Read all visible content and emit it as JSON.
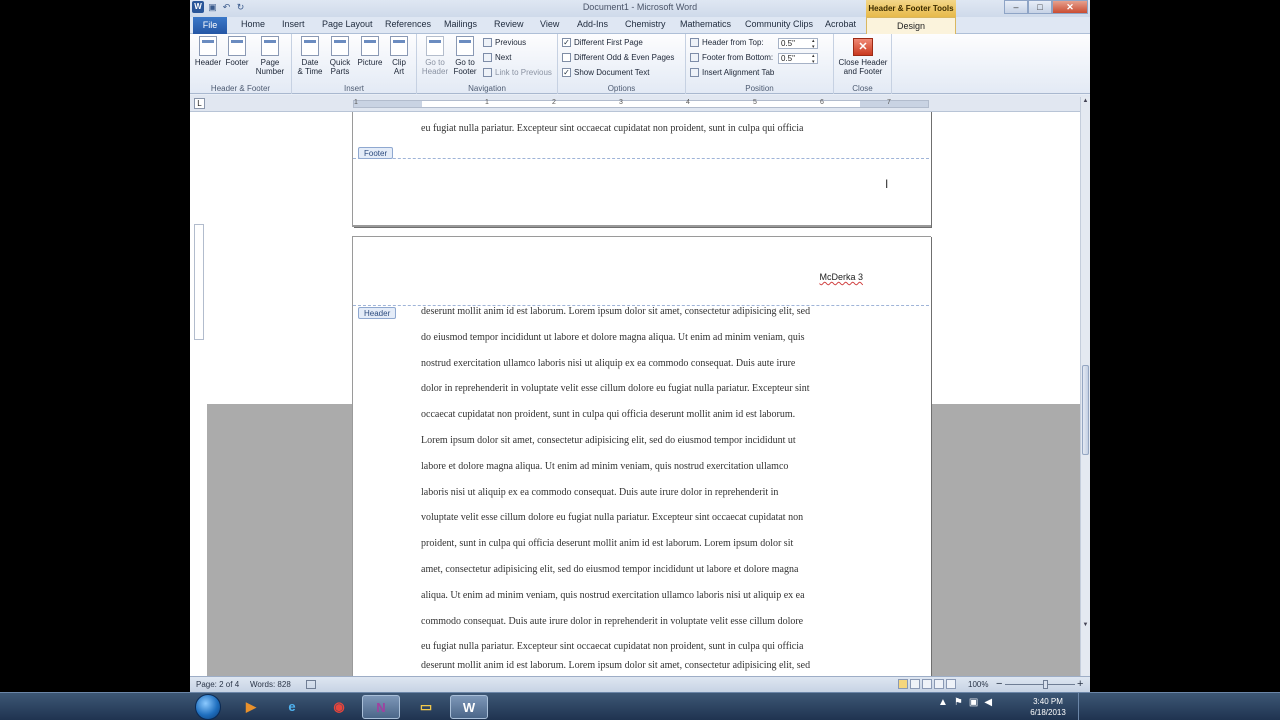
{
  "window": {
    "title": "Document1 - Microsoft Word",
    "context_tools_label": "Header & Footer Tools",
    "buttons": {
      "minimize": "–",
      "maximize": "□",
      "close": "✕"
    }
  },
  "quick_access": {
    "app_letter": "W",
    "save": "▣",
    "undo": "↶",
    "redo": "↻"
  },
  "tabs": {
    "file": "File",
    "items": [
      "Home",
      "Insert",
      "Page Layout",
      "References",
      "Mailings",
      "Review",
      "View",
      "Add-Ins",
      "Chemistry",
      "Mathematics",
      "Community Clips",
      "Acrobat"
    ],
    "design": "Design"
  },
  "ribbon": {
    "header_footer": {
      "label": "Header & Footer",
      "header": "Header",
      "footer": "Footer",
      "page_number_l1": "Page",
      "page_number_l2": "Number"
    },
    "insert": {
      "label": "Insert",
      "date_time_l1": "Date",
      "date_time_l2": "& Time",
      "quick_parts_l1": "Quick",
      "quick_parts_l2": "Parts",
      "picture": "Picture",
      "clip_art_l1": "Clip",
      "clip_art_l2": "Art"
    },
    "navigation": {
      "label": "Navigation",
      "go_to_header_l1": "Go to",
      "go_to_header_l2": "Header",
      "go_to_footer_l1": "Go to",
      "go_to_footer_l2": "Footer",
      "previous": "Previous",
      "next": "Next",
      "link_to_previous": "Link to Previous"
    },
    "options": {
      "label": "Options",
      "different_first_page": "Different First Page",
      "different_odd_even": "Different Odd & Even Pages",
      "show_document_text": "Show Document Text",
      "checked_mark": "✓"
    },
    "position": {
      "label": "Position",
      "header_from_top": "Header from Top:",
      "header_from_top_value": "0.5\"",
      "footer_from_bottom": "Footer from Bottom:",
      "footer_from_bottom_value": "0.5\"",
      "insert_alignment_tab": "Insert Alignment Tab"
    },
    "close": {
      "label": "Close",
      "close_l1": "Close Header",
      "close_l2": "and Footer",
      "icon_glyph": "✕"
    }
  },
  "ruler": {
    "tab_selector": "L",
    "numbers": [
      "1",
      "1",
      "2",
      "3",
      "4",
      "5",
      "6",
      "7"
    ]
  },
  "document": {
    "page1_last_line": "eu fugiat nulla pariatur. Excepteur sint occaecat cupidatat non proident, sunt in culpa qui officia",
    "footer_tag": "Footer",
    "header_tag": "Header",
    "header_text": "McDerka 3",
    "page2_lines": [
      "deserunt mollit anim id est laborum. Lorem ipsum dolor sit amet, consectetur adipisicing elit, sed",
      "do eiusmod tempor incididunt ut labore et dolore magna aliqua. Ut enim ad minim veniam, quis",
      "nostrud exercitation ullamco laboris nisi ut aliquip ex ea commodo consequat. Duis aute irure",
      "dolor in reprehenderit in voluptate velit esse cillum dolore eu fugiat nulla pariatur. Excepteur sint",
      "occaecat cupidatat non proident, sunt in culpa qui officia deserunt mollit anim id est laborum.",
      "Lorem ipsum dolor sit amet, consectetur adipisicing elit, sed do eiusmod tempor incididunt ut",
      "labore et dolore magna aliqua. Ut enim ad minim veniam, quis nostrud exercitation ullamco",
      "laboris nisi ut aliquip ex ea commodo consequat. Duis aute irure dolor in reprehenderit in",
      "voluptate velit esse cillum dolore eu fugiat nulla pariatur. Excepteur sint occaecat cupidatat non",
      "proident, sunt in culpa qui officia deserunt mollit anim id est laborum. Lorem ipsum dolor sit",
      "amet, consectetur adipisicing elit, sed do eiusmod tempor incididunt ut labore et dolore magna",
      "aliqua. Ut enim ad minim veniam, quis nostrud exercitation ullamco laboris nisi ut aliquip ex ea",
      "commodo consequat. Duis aute irure dolor in reprehenderit in voluptate velit esse cillum dolore",
      "eu fugiat nulla pariatur. Excepteur sint occaecat cupidatat non proident, sunt in culpa qui officia",
      "deserunt mollit anim id est laborum. Lorem ipsum dolor sit amet, consectetur adipisicing elit, sed"
    ],
    "cursor_glyph": "I"
  },
  "scrollbar": {
    "up": "▲",
    "down": "▼"
  },
  "statusbar": {
    "page": "Page: 2 of 4",
    "words": "Words: 828",
    "zoom": "100%",
    "zoom_out": "−",
    "zoom_in": "+"
  },
  "taskbar": {
    "items": [
      {
        "name": "media-player",
        "glyph": "▶",
        "color": "#e9912c"
      },
      {
        "name": "internet-explorer",
        "glyph": "e",
        "color": "#4fb3f0"
      },
      {
        "name": "chrome",
        "glyph": "◉",
        "color": "#e8453c"
      },
      {
        "name": "onenote",
        "glyph": "N",
        "color": "#a040a0"
      },
      {
        "name": "file-explorer",
        "glyph": "▭",
        "color": "#f1c84b"
      },
      {
        "name": "word",
        "glyph": "W",
        "color": "#ffffff"
      }
    ],
    "tray": {
      "show_hidden": "▲",
      "flag": "⚑",
      "network": "▣",
      "volume": "◀"
    },
    "time": "3:40 PM",
    "date": "6/18/2013"
  },
  "colors": {
    "accent": "#2456a5",
    "context_tab": "#e7b94a",
    "spellcheck_underline": "#d04040"
  }
}
